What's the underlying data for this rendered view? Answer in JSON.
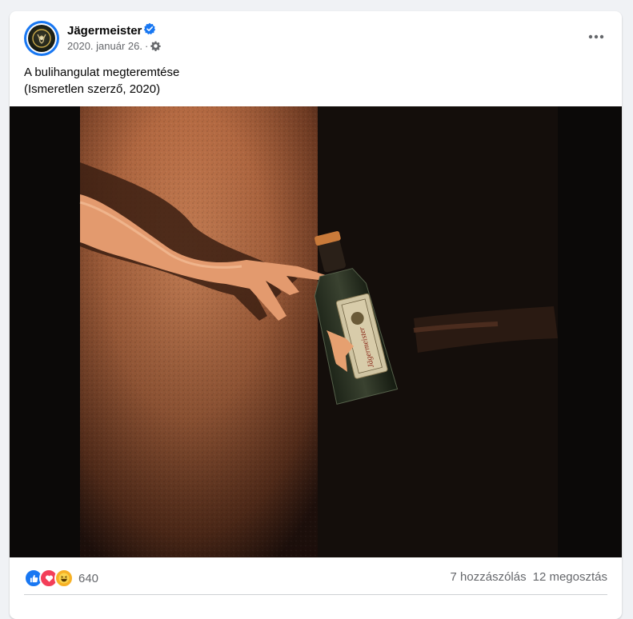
{
  "post": {
    "page_name": "Jägermeister",
    "verified_icon": "verified-badge-icon",
    "date": "2020. január 26.",
    "separator": "·",
    "audience_icon": "gear-icon",
    "more_icon": "more-options-icon",
    "caption_line1": "A bulihangulat megteremtése",
    "caption_line2": "(Ismeretlen szerző, 2020)",
    "bottle_label": "Jägermeister"
  },
  "reactions": {
    "icons": [
      "like-icon",
      "love-icon",
      "haha-icon"
    ],
    "count": "640"
  },
  "stats": {
    "comments": "7 hozzászólás",
    "shares": "12 megosztás"
  },
  "colors": {
    "accent": "#1877f2",
    "background": "#f0f2f5",
    "secondary_text": "#65676b",
    "love": "#f33e58",
    "haha": "#f7b125"
  }
}
